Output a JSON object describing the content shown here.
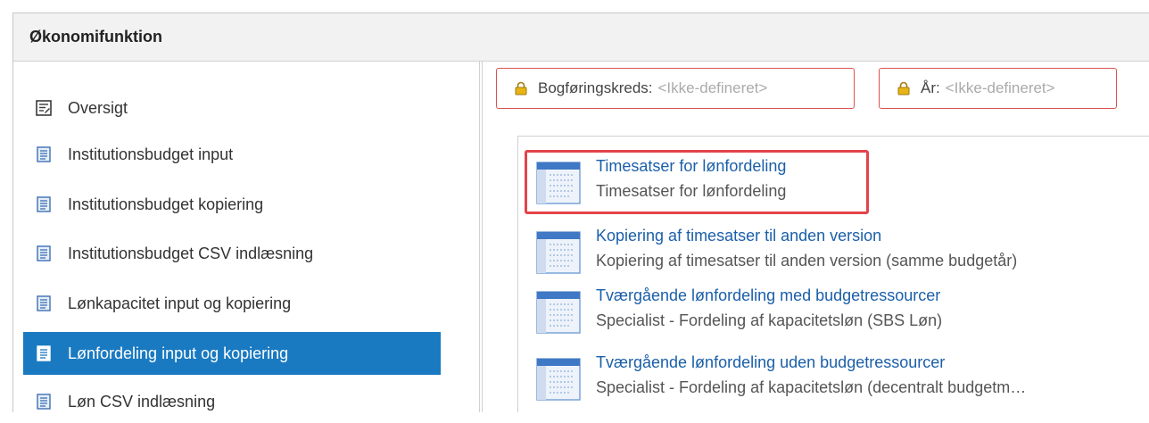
{
  "panel": {
    "title": "Økonomifunktion"
  },
  "sidebar": {
    "items": [
      {
        "label": "Oversigt",
        "icon": "overview-icon"
      },
      {
        "label": "Institutionsbudget input",
        "icon": "document-icon"
      },
      {
        "label": "Institutionsbudget kopiering",
        "icon": "document-icon"
      },
      {
        "label": "Institutionsbudget CSV indlæsning",
        "icon": "document-icon"
      },
      {
        "label": "Lønkapacitet input og kopiering",
        "icon": "document-icon"
      },
      {
        "label": "Lønfordeling input og kopiering",
        "icon": "document-icon",
        "active": true
      },
      {
        "label": "Løn CSV indlæsning",
        "icon": "document-icon"
      }
    ]
  },
  "filters": {
    "bogforing": {
      "label": "Bogføringskreds:",
      "value": "<Ikke-defineret>",
      "icon": "lock-icon"
    },
    "aar": {
      "label": "År:",
      "value": "<Ikke-defineret>",
      "icon": "lock-icon"
    }
  },
  "tasks": [
    {
      "title": "Timesatser for lønfordeling",
      "description": "Timesatser for lønfordeling",
      "icon": "table-icon",
      "highlighted": true
    },
    {
      "title": "Kopiering af timesatser til anden version",
      "description": "Kopiering af timesatser til anden version (samme budgetår)",
      "icon": "table-icon"
    },
    {
      "title": "Tværgående lønfordeling med budgetressourcer",
      "description": "Specialist - Fordeling af kapacitetsløn (SBS Løn)",
      "icon": "table-icon"
    },
    {
      "title": "Tværgående lønfordeling uden budgetressourcer",
      "description": "Specialist - Fordeling af kapacitetsløn (decentralt budgetm…",
      "icon": "table-icon"
    }
  ],
  "colors": {
    "active_bg": "#1a7ac1",
    "link": "#1b5fa8",
    "filter_border": "#d9534f",
    "highlight": "#e3434a"
  }
}
